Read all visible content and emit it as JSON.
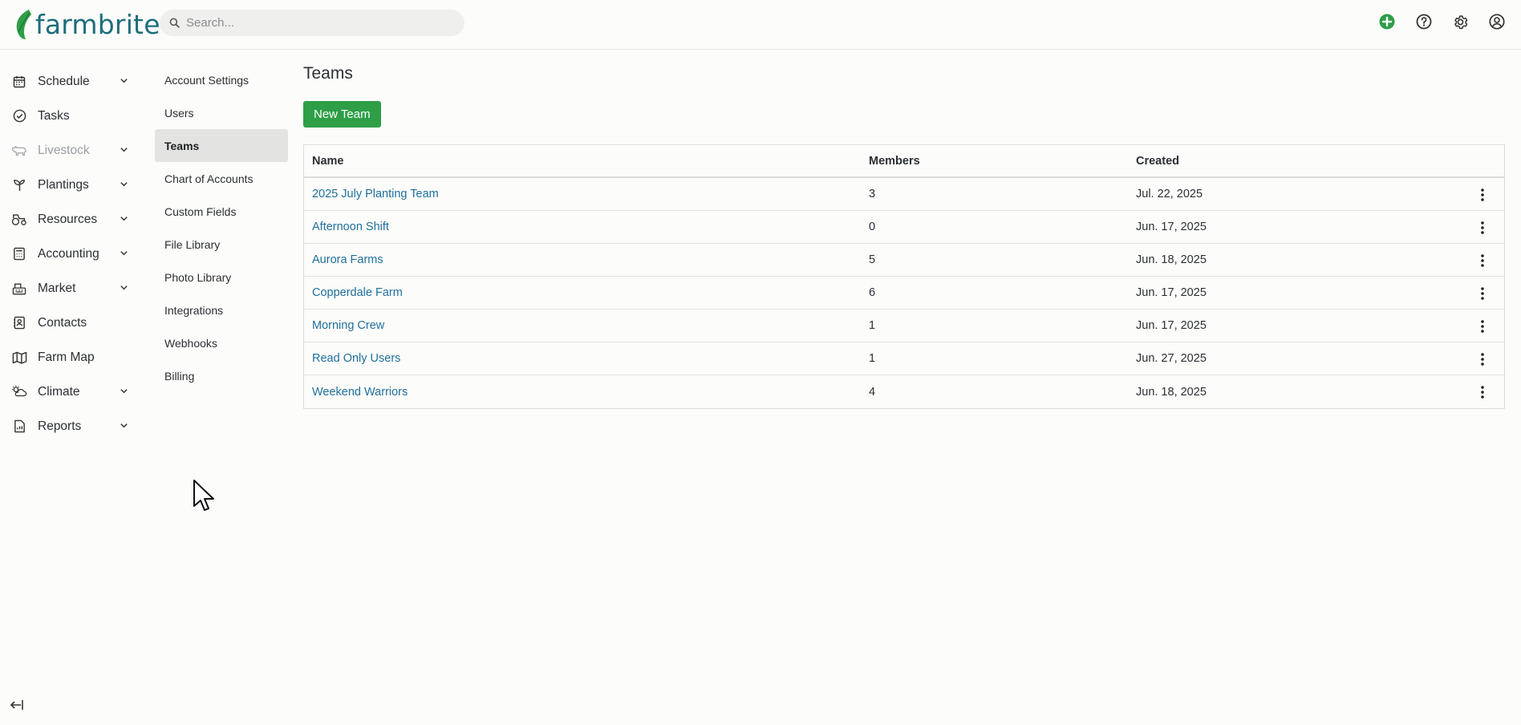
{
  "brand": {
    "name": "farmbrite",
    "accent": "#2e9e47",
    "link_color": "#1f6f9c"
  },
  "search": {
    "placeholder": "Search..."
  },
  "header_icons": [
    "add-circle-icon",
    "help-icon",
    "gear-icon",
    "user-account-icon"
  ],
  "sidebar": {
    "items": [
      {
        "label": "Schedule",
        "icon": "calendar-icon",
        "expandable": true
      },
      {
        "label": "Tasks",
        "icon": "check-circle-icon",
        "expandable": false
      },
      {
        "label": "Livestock",
        "icon": "livestock-icon",
        "expandable": true,
        "disabled": true
      },
      {
        "label": "Plantings",
        "icon": "sprout-icon",
        "expandable": true
      },
      {
        "label": "Resources",
        "icon": "tractor-icon",
        "expandable": true
      },
      {
        "label": "Accounting",
        "icon": "calculator-icon",
        "expandable": true
      },
      {
        "label": "Market",
        "icon": "register-icon",
        "expandable": true
      },
      {
        "label": "Contacts",
        "icon": "contact-card-icon",
        "expandable": false
      },
      {
        "label": "Farm Map",
        "icon": "map-icon",
        "expandable": false
      },
      {
        "label": "Climate",
        "icon": "weather-icon",
        "expandable": true
      },
      {
        "label": "Reports",
        "icon": "report-icon",
        "expandable": true
      }
    ]
  },
  "settings_nav": {
    "items": [
      {
        "label": "Account Settings"
      },
      {
        "label": "Users"
      },
      {
        "label": "Teams",
        "active": true
      },
      {
        "label": "Chart of Accounts"
      },
      {
        "label": "Custom Fields"
      },
      {
        "label": "File Library"
      },
      {
        "label": "Photo Library"
      },
      {
        "label": "Integrations"
      },
      {
        "label": "Webhooks"
      },
      {
        "label": "Billing"
      }
    ]
  },
  "main": {
    "title": "Teams",
    "new_button": "New Team",
    "table": {
      "columns": [
        "Name",
        "Members",
        "Created"
      ],
      "rows": [
        {
          "name": "2025 July Planting Team",
          "members": "3",
          "created": "Jul. 22, 2025"
        },
        {
          "name": "Afternoon Shift",
          "members": "0",
          "created": "Jun. 17, 2025"
        },
        {
          "name": "Aurora Farms",
          "members": "5",
          "created": "Jun. 18, 2025"
        },
        {
          "name": "Copperdale Farm",
          "members": "6",
          "created": "Jun. 17, 2025"
        },
        {
          "name": "Morning Crew",
          "members": "1",
          "created": "Jun. 17, 2025"
        },
        {
          "name": "Read Only Users",
          "members": "1",
          "created": "Jun. 27, 2025"
        },
        {
          "name": "Weekend Warriors",
          "members": "4",
          "created": "Jun. 18, 2025"
        }
      ]
    }
  }
}
